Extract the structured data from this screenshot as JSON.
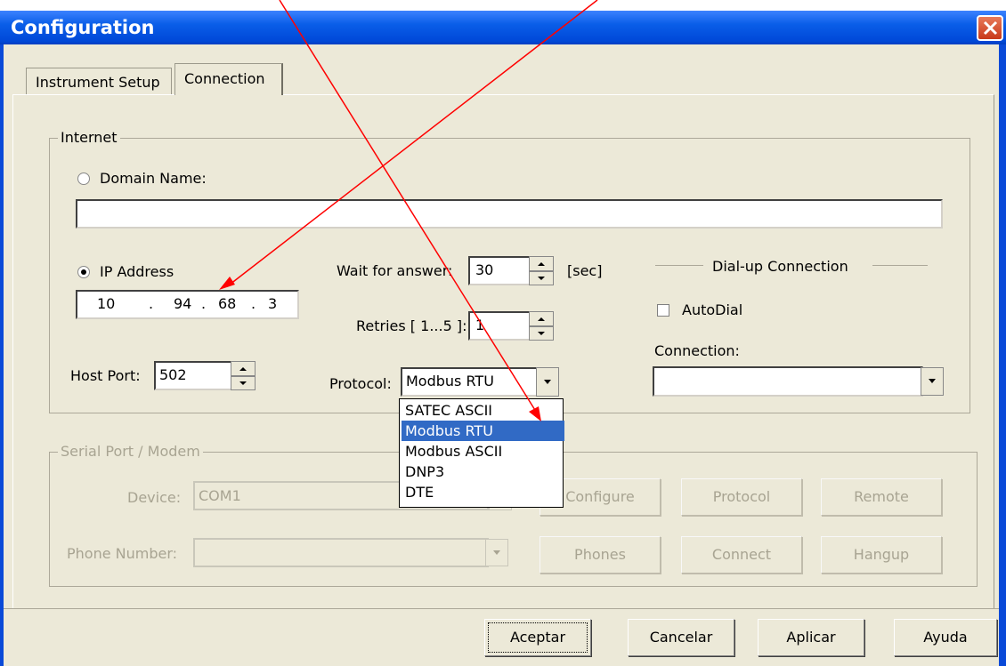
{
  "window": {
    "title": "Configuration"
  },
  "tabs": [
    "Instrument Setup",
    "Connection"
  ],
  "internet": {
    "group_label": "Internet",
    "domain_label": "Domain Name:",
    "domain_value": "",
    "ip_label": "IP Address",
    "ip": [
      "10",
      "94",
      "68",
      "3"
    ],
    "ip_dot": ".",
    "host_port_label": "Host Port:",
    "host_port": "502"
  },
  "timing": {
    "wait_label": "Wait for answer:",
    "wait_value": "30",
    "wait_unit": "[sec]",
    "retries_label": "Retries [ 1...5 ]:",
    "retries_value": "1",
    "protocol_label": "Protocol:",
    "protocol_value": "Modbus RTU",
    "protocol_options": [
      "SATEC ASCII",
      "Modbus RTU",
      "Modbus ASCII",
      "DNP3",
      "DTE"
    ]
  },
  "dialup": {
    "header": "Dial-up Connection",
    "autodial_label": "AutoDial",
    "connection_label": "Connection:",
    "connection_value": ""
  },
  "serial": {
    "group_label": "Serial Port / Modem",
    "device_label": "Device:",
    "device_value": "COM1",
    "phone_label": "Phone Number:",
    "phone_value": "",
    "buttons": [
      "Configure",
      "Protocol",
      "Remote",
      "Phones",
      "Connect",
      "Hangup"
    ]
  },
  "footer": {
    "buttons": [
      "Aceptar",
      "Cancelar",
      "Aplicar",
      "Ayuda"
    ]
  },
  "colors": {
    "annotation_arrow": "#ff0000",
    "selection": "#316ac5",
    "title_bar": "#0a5ee8"
  }
}
